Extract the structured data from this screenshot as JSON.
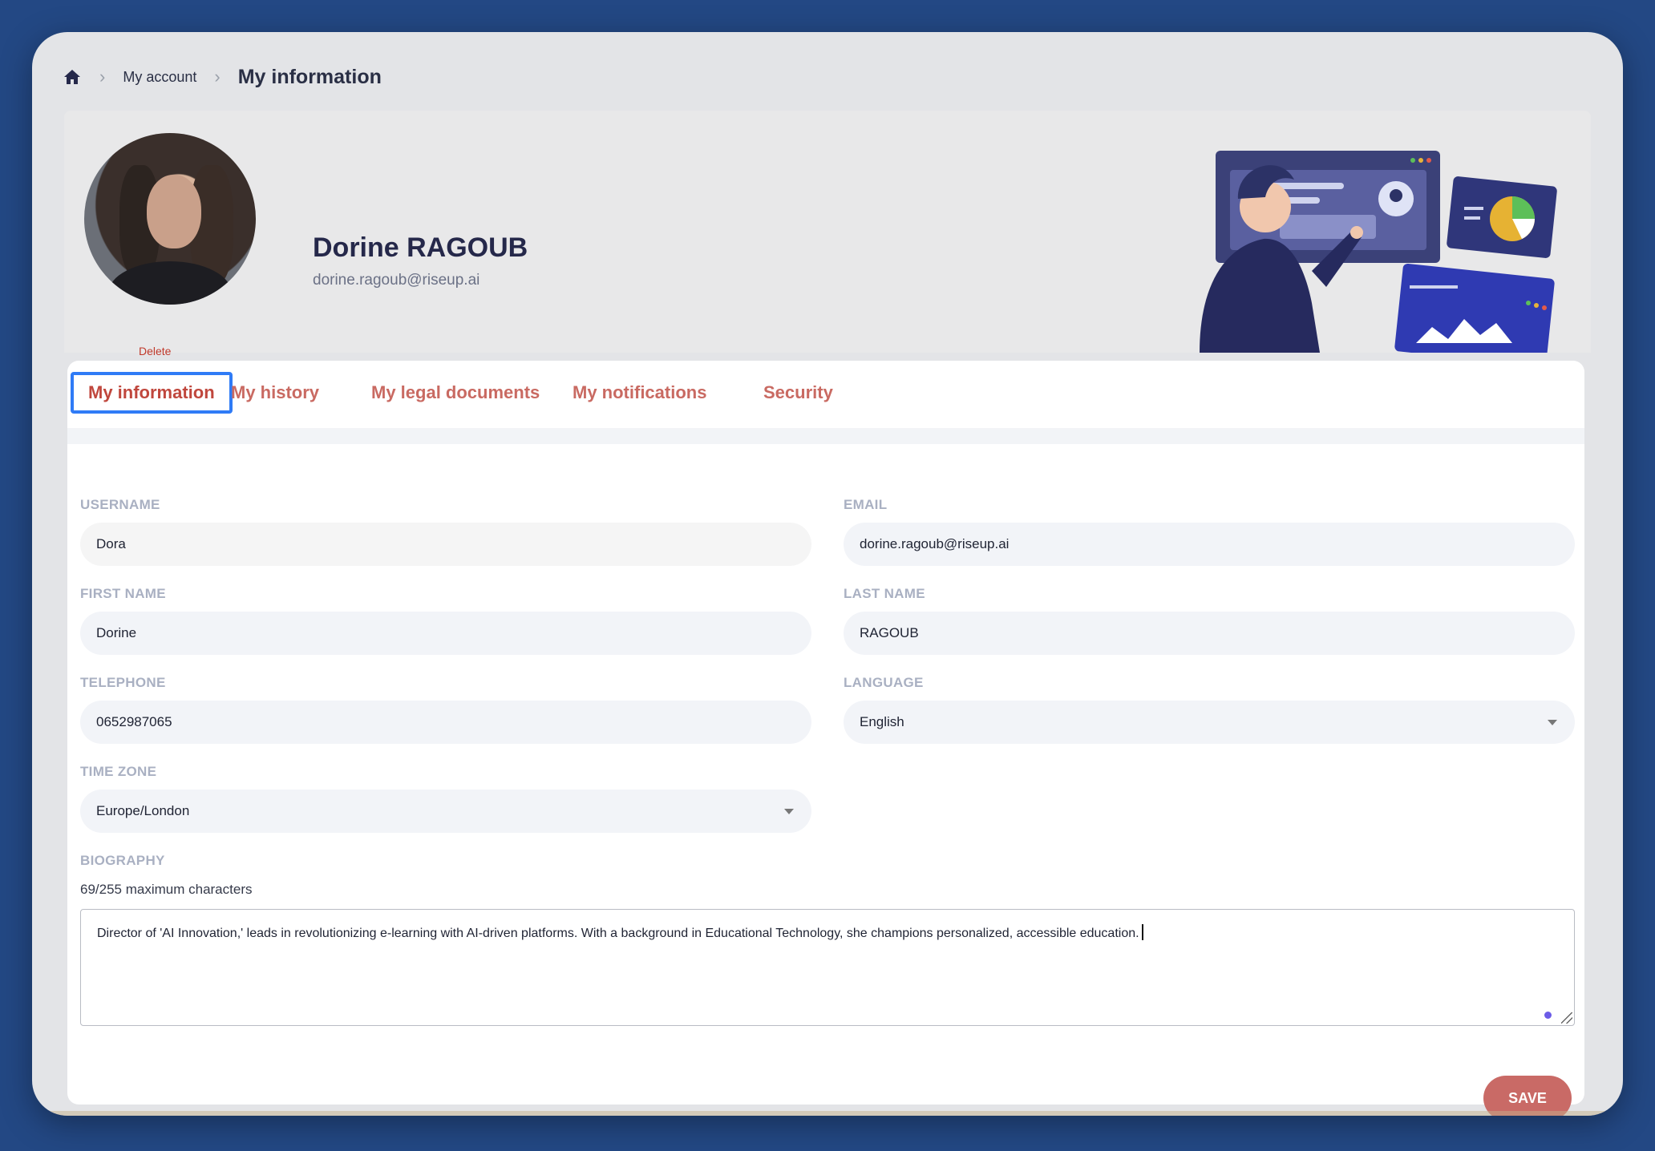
{
  "breadcrumb": {
    "home_icon": "home-icon",
    "separator": "›",
    "my_account": "My account",
    "current": "My information"
  },
  "profile": {
    "name": "Dorine RAGOUB",
    "email": "dorine.ragoub@riseup.ai",
    "delete_label": "Delete"
  },
  "tabs": [
    {
      "label": "My information",
      "active": true
    },
    {
      "label": "My history",
      "active": false
    },
    {
      "label": "My legal documents",
      "active": false
    },
    {
      "label": "My notifications",
      "active": false
    },
    {
      "label": "Security",
      "active": false
    }
  ],
  "form": {
    "username": {
      "label": "USERNAME",
      "value": "Dora"
    },
    "email": {
      "label": "EMAIL",
      "value": "dorine.ragoub@riseup.ai"
    },
    "first_name": {
      "label": "FIRST NAME",
      "value": "Dorine"
    },
    "last_name": {
      "label": "LAST NAME",
      "value": "RAGOUB"
    },
    "telephone": {
      "label": "TELEPHONE",
      "value": "0652987065"
    },
    "language": {
      "label": "LANGUAGE",
      "value": "English"
    },
    "time_zone": {
      "label": "TIME ZONE",
      "value": "Europe/London"
    },
    "biography": {
      "label": "BIOGRAPHY",
      "counter": "69/255 maximum characters",
      "value": "Director of 'AI Innovation,' leads in revolutionizing e-learning with AI-driven platforms. With a background in Educational Technology, she champions personalized, accessible education."
    }
  },
  "save_label": "SAVE",
  "colors": {
    "background": "#234884",
    "accent": "#c96a66",
    "tab_focus": "#2f7bf6",
    "heading": "#25284a"
  }
}
